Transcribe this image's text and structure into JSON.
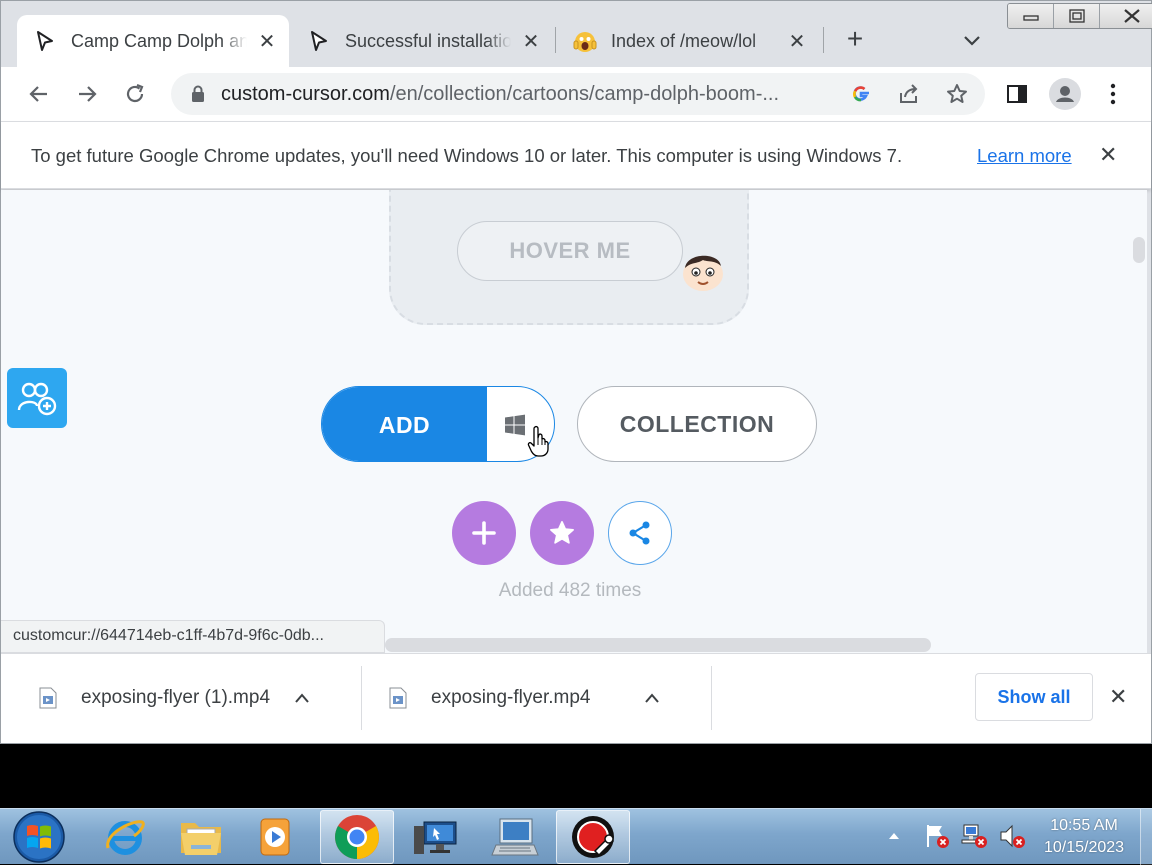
{
  "tabs": [
    {
      "title": "Camp Camp Dolph and",
      "active": true
    },
    {
      "title": "Successful installation",
      "active": false
    },
    {
      "title": "Index of /meow/lol",
      "active": false
    }
  ],
  "new_tab_symbol": "+",
  "url": {
    "host": "custom-cursor.com",
    "path": "/en/collection/cartoons/camp-dolph-boom-..."
  },
  "infobar": {
    "message": "To get future Google Chrome updates, you'll need Windows 10 or later. This computer is using Windows 7.",
    "link": "Learn more"
  },
  "page": {
    "hover_label": "HOVER ME",
    "add_label": "ADD",
    "collection_label": "COLLECTION",
    "added_text": "Added 482 times",
    "status_url": "customcur://644714eb-c1ff-4b7d-9f6c-0db..."
  },
  "downloads": {
    "items": [
      {
        "name": "exposing-flyer (1).mp4"
      },
      {
        "name": "exposing-flyer.mp4"
      }
    ],
    "show_all": "Show all"
  },
  "taskbar": {
    "apps": [
      "internet-explorer",
      "windows-explorer",
      "media-player",
      "chrome",
      "remote-desktop",
      "network-computer",
      "cursor-tool"
    ],
    "time": "10:55 AM",
    "date": "10/15/2023"
  },
  "colors": {
    "accent_blue": "#1a87e4",
    "purple": "#b57be0",
    "link_blue": "#1a73e8"
  }
}
